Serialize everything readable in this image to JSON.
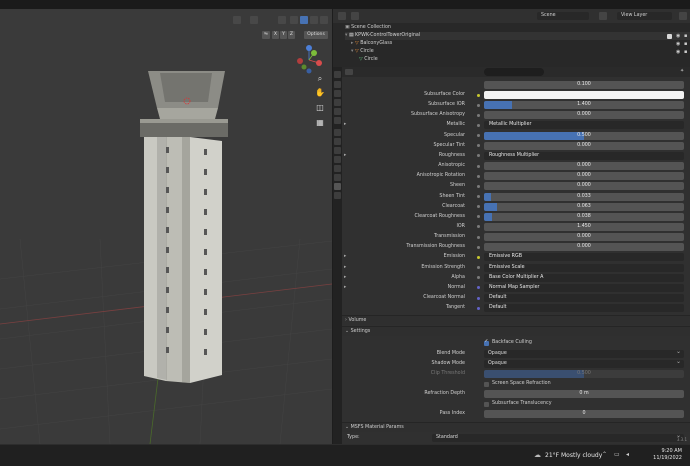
{
  "viewport": {
    "options_label": "Options",
    "axis_x": "X",
    "axis_y": "Y",
    "axis_z": "Z"
  },
  "header": {
    "scene_label": "Scene",
    "view_layer_label": "View Layer"
  },
  "outliner": {
    "items": [
      {
        "label": "Scene Collection"
      },
      {
        "label": "KPWK-ControlTowerOriginal"
      },
      {
        "label": "BalconyGlass"
      },
      {
        "label": "Circle"
      },
      {
        "label": "Circle"
      }
    ]
  },
  "properties": {
    "top_value": "0.100",
    "rows": [
      {
        "label": "Subsurface Color",
        "socket": "yellow",
        "kind": "color",
        "value": ""
      },
      {
        "label": "Subsurface IOR",
        "socket": "gray",
        "kind": "slider",
        "value": "1.400",
        "fraction": 0.14
      },
      {
        "label": "Subsurface Anisotropy",
        "socket": "gray",
        "kind": "slider",
        "value": "0.000",
        "fraction": 0
      },
      {
        "label": "Metallic",
        "socket": "gray",
        "kind": "link",
        "value": "Metallic Multiplier",
        "expandable": true
      },
      {
        "label": "Specular",
        "socket": "gray",
        "kind": "slider",
        "value": "0.500",
        "fraction": 0.5
      },
      {
        "label": "Specular Tint",
        "socket": "gray",
        "kind": "slider",
        "value": "0.000",
        "fraction": 0
      },
      {
        "label": "Roughness",
        "socket": "gray",
        "kind": "link",
        "value": "Roughness Multiplier",
        "expandable": true
      },
      {
        "label": "Anisotropic",
        "socket": "gray",
        "kind": "slider",
        "value": "0.000",
        "fraction": 0
      },
      {
        "label": "Anisotropic Rotation",
        "socket": "gray",
        "kind": "slider",
        "value": "0.000",
        "fraction": 0
      },
      {
        "label": "Sheen",
        "socket": "gray",
        "kind": "slider",
        "value": "0.000",
        "fraction": 0
      },
      {
        "label": "Sheen Tint",
        "socket": "gray",
        "kind": "slider",
        "value": "0.033",
        "fraction": 0.033
      },
      {
        "label": "Clearcoat",
        "socket": "gray",
        "kind": "slider",
        "value": "0.063",
        "fraction": 0.063
      },
      {
        "label": "Clearcoat Roughness",
        "socket": "gray",
        "kind": "slider",
        "value": "0.038",
        "fraction": 0.038
      },
      {
        "label": "IOR",
        "socket": "gray",
        "kind": "slider",
        "value": "1.450",
        "fraction": 0
      },
      {
        "label": "Transmission",
        "socket": "gray",
        "kind": "slider",
        "value": "0.000",
        "fraction": 0
      },
      {
        "label": "Transmission Roughness",
        "socket": "gray",
        "kind": "slider",
        "value": "0.000",
        "fraction": 0
      },
      {
        "label": "Emission",
        "socket": "yellow",
        "kind": "link",
        "value": "Emissive RGB",
        "expandable": true
      },
      {
        "label": "Emission Strength",
        "socket": "gray",
        "kind": "link",
        "value": "Emissive Scale",
        "expandable": true
      },
      {
        "label": "Alpha",
        "socket": "gray",
        "kind": "link",
        "value": "Base Color Multiplier A",
        "expandable": true
      },
      {
        "label": "Normal",
        "socket": "purple",
        "kind": "link",
        "value": "Normal Map Sampler",
        "expandable": true
      },
      {
        "label": "Clearcoat Normal",
        "socket": "purple",
        "kind": "link",
        "value": "Default"
      },
      {
        "label": "Tangent",
        "socket": "purple",
        "kind": "link",
        "value": "Default"
      }
    ],
    "volume_section": "Volume",
    "settings_section": "Settings",
    "backface_culling": "Backface Culling",
    "blend_mode_label": "Blend Mode",
    "blend_mode_value": "Opaque",
    "shadow_mode_label": "Shadow Mode",
    "shadow_mode_value": "Opaque",
    "clip_threshold_label": "Clip Threshold",
    "clip_threshold_value": "0.500",
    "clip_threshold_fraction": 0.5,
    "screen_space_refraction": "Screen Space Refraction",
    "refraction_depth_label": "Refraction Depth",
    "refraction_depth_value": "0 m",
    "subsurface_translucency": "Subsurface Translucency",
    "pass_index_label": "Pass Index",
    "pass_index_value": "0",
    "msfs_section": "MSFS Material Params",
    "type_label": "Type:",
    "type_value": "Standard"
  },
  "taskbar": {
    "weather": "21°F  Mostly cloudy",
    "time": "9:20 AM",
    "date": "11/19/2022"
  },
  "version": "3.3.1",
  "colors": {
    "accent": "#4772b3",
    "socket_yellow": "#c7c72e",
    "socket_purple": "#6363c7",
    "socket_gray": "#7a7a7a"
  }
}
